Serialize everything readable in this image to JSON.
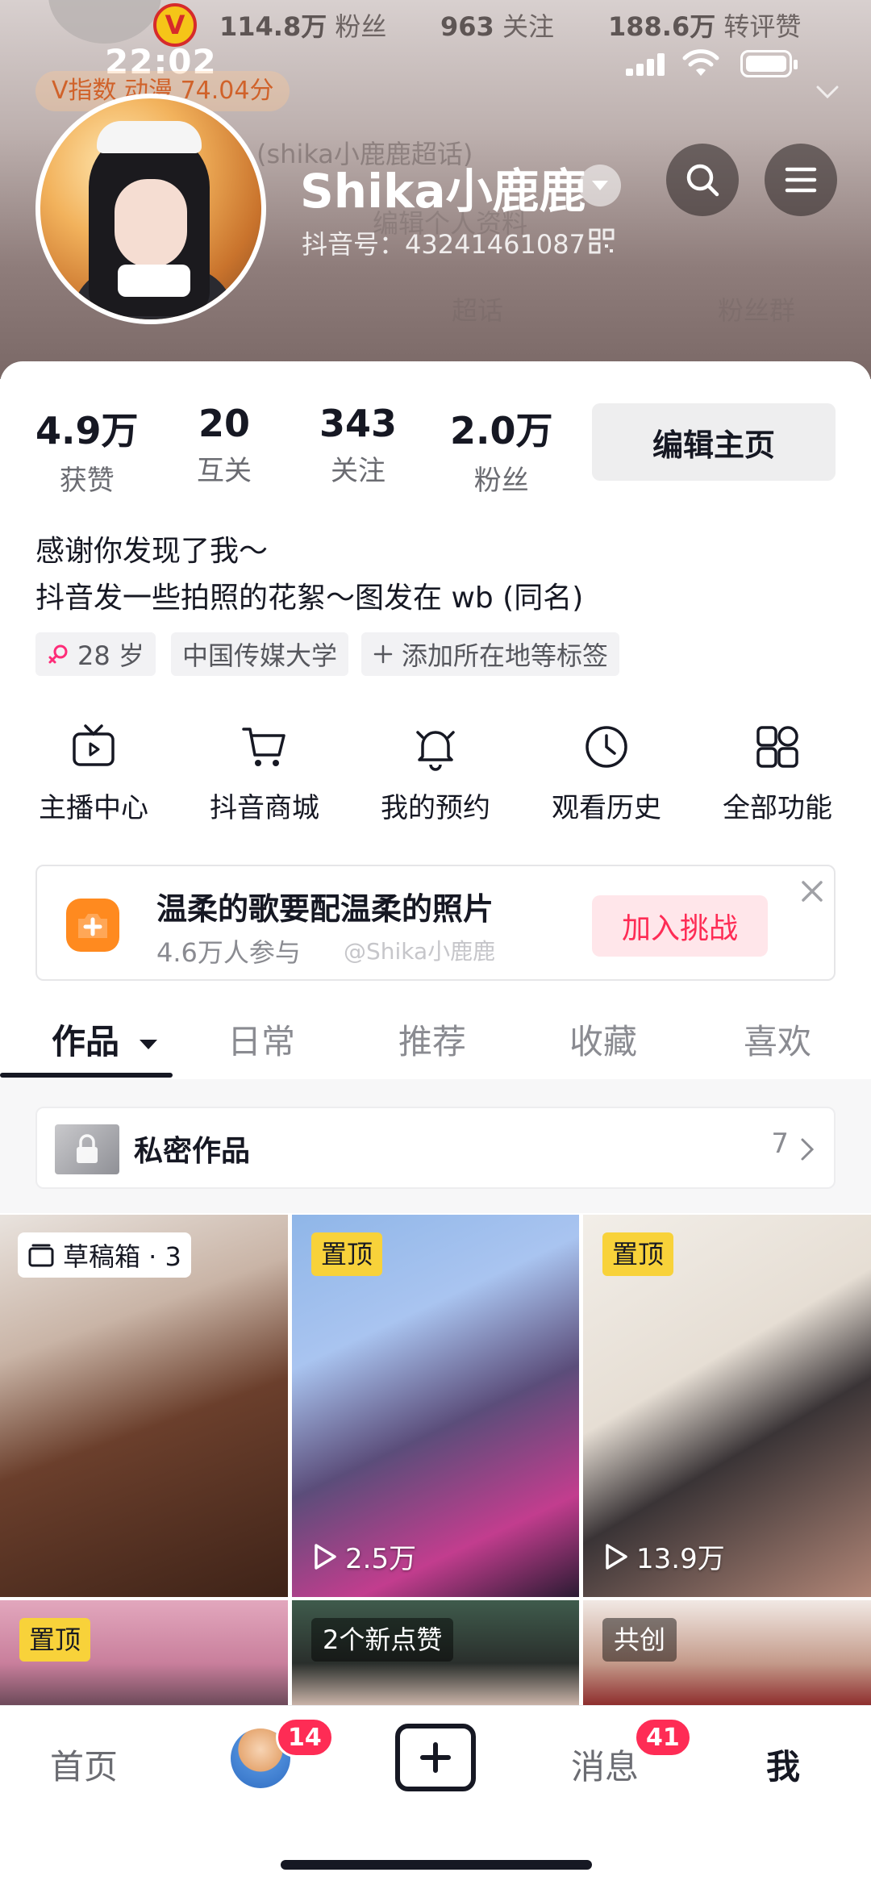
{
  "status_bar": {
    "time": "22:02"
  },
  "ghost_header": {
    "fans": "114.8万",
    "fans_label": "粉丝",
    "following": "963",
    "following_label": "关注",
    "likes": "188.6万",
    "likes_label": "转评赞",
    "v_index": "V指数 动漫 74.04分",
    "super_topic": "(shika小鹿鹿超话)",
    "edit_hint": "编辑个人资料",
    "ghost_tab1": "超话",
    "ghost_tab2": "粉丝群"
  },
  "profile": {
    "name": "Shika小鹿鹿",
    "douyin_id": "抖音号：43241461087"
  },
  "stats": [
    {
      "value": "4.9万",
      "label": "获赞"
    },
    {
      "value": "20",
      "label": "互关"
    },
    {
      "value": "343",
      "label": "关注"
    },
    {
      "value": "2.0万",
      "label": "粉丝"
    }
  ],
  "edit_button": "编辑主页",
  "bio": {
    "line1": "感谢你发现了我～",
    "line2": "抖音发一些拍照的花絮～图发在 wb (同名)"
  },
  "tags": {
    "age": "28 岁",
    "school": "中国传媒大学",
    "add": "添加所在地等标签"
  },
  "functions": [
    {
      "label": "主播中心",
      "icon": "tv-icon"
    },
    {
      "label": "抖音商城",
      "icon": "cart-icon"
    },
    {
      "label": "我的预约",
      "icon": "bell-icon"
    },
    {
      "label": "观看历史",
      "icon": "clock-icon"
    },
    {
      "label": "全部功能",
      "icon": "grid-icon"
    }
  ],
  "challenge": {
    "title": "温柔的歌要配温柔的照片",
    "participants": "4.6万人参与",
    "watermark": "@Shika小鹿鹿",
    "join_label": "加入挑战"
  },
  "tabs": [
    "作品",
    "日常",
    "推荐",
    "收藏",
    "喜欢"
  ],
  "private": {
    "label": "私密作品",
    "count": "7"
  },
  "grid": {
    "drafts": "草稿箱 · 3",
    "pinned": "置顶",
    "cell2_plays": "2.5万",
    "cell3_plays": "13.9万",
    "new_likes": "2个新点赞",
    "cocreate": "共创"
  },
  "bottom_nav": {
    "home": "首页",
    "friends_badge": "14",
    "messages": "消息",
    "messages_badge": "41",
    "me": "我"
  },
  "colors": {
    "accent": "#fe2c55",
    "pin_badge": "#f8d23a",
    "challenge_icon": "#ff8a1f"
  }
}
